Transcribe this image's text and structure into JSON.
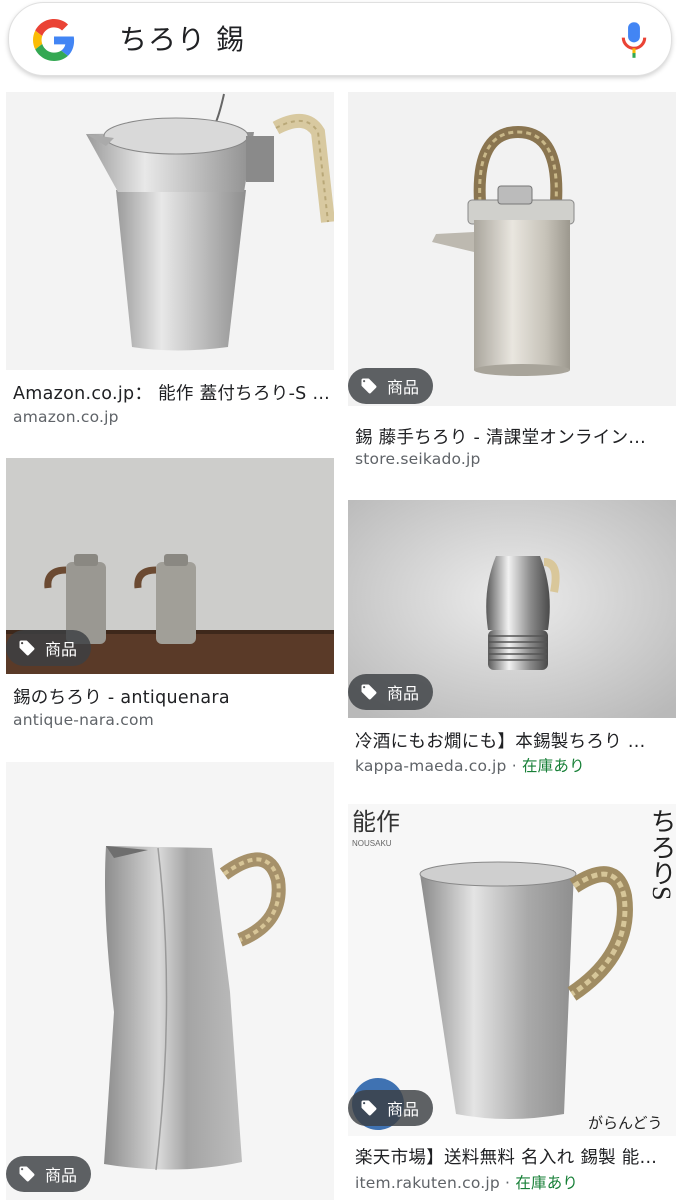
{
  "search": {
    "query": "ちろり 錫"
  },
  "results": [
    {
      "caption": "Amazon.co.jp： 能作 蓋付ちろり-S ...",
      "source": "amazon.co.jp",
      "badge": "",
      "stock": ""
    },
    {
      "caption": "錫 藤手ちろり - 清課堂オンライン...",
      "source": "store.seikado.jp",
      "badge": "商品",
      "stock": ""
    },
    {
      "caption": "錫のちろり - antiquenara",
      "source": "antique-nara.com",
      "badge": "商品",
      "stock": ""
    },
    {
      "caption": "冷酒にもお燗にも】本錫製ちろり ...",
      "source": "kappa-maeda.co.jp",
      "badge": "商品",
      "stock": "在庫あり"
    },
    {
      "caption": "",
      "source": "",
      "badge": "商品",
      "stock": ""
    },
    {
      "caption": "楽天市場】送料無料 名入れ 錫製 能...",
      "source": "item.rakuten.co.jp",
      "badge": "商品",
      "stock": "在庫あり"
    }
  ],
  "image_text": {
    "brand_label": "能作",
    "brand_sub": "NOUSAKU",
    "vertical_text": "ちろりS",
    "shop_logo": "がらんどう"
  },
  "separator": " · ",
  "colors": {
    "stock_green": "#188038",
    "source_gray": "#5f6368",
    "google_blue": "#4285F4",
    "google_red": "#EA4335",
    "google_yellow": "#FBBC05",
    "google_green": "#34A853"
  },
  "icons": {
    "logo": "google-g-logo",
    "mic": "microphone-icon",
    "badge": "tag-icon"
  }
}
